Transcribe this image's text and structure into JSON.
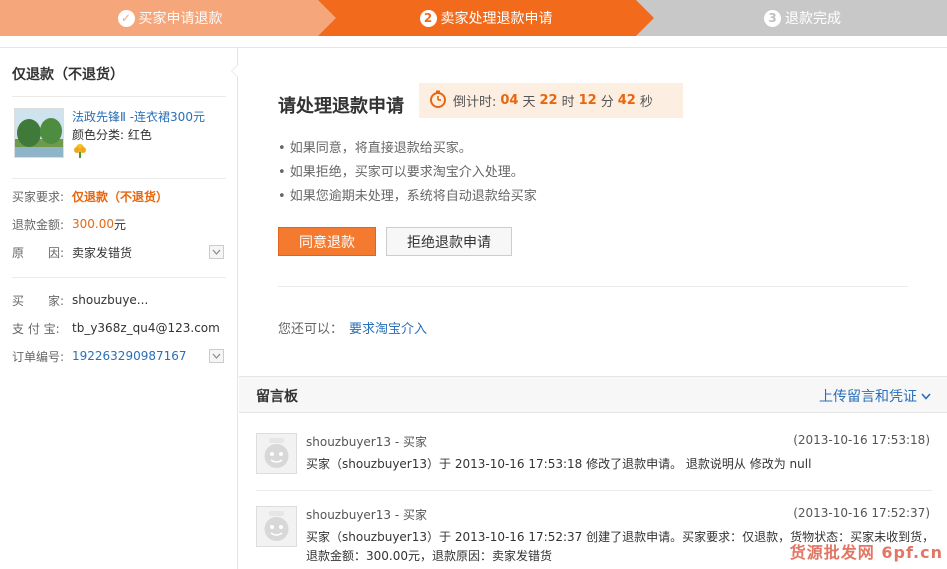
{
  "steps": [
    {
      "label": "买家申请退款",
      "state": "done"
    },
    {
      "label": "卖家处理退款申请",
      "num": "2",
      "state": "current"
    },
    {
      "label": "退款完成",
      "num": "3",
      "state": "todo"
    }
  ],
  "colors": {
    "step_done": "#f6a67b",
    "step_current": "#f26b1d",
    "step_todo": "#c8c8c8",
    "accent": "#e8660e",
    "link": "#2a6fb8"
  },
  "sidebar": {
    "title": "仅退款（不退货）",
    "product": {
      "name": "法政先锋Ⅱ -连衣裙300元",
      "attr": "颜色分类: 红色"
    },
    "details": [
      {
        "key": "买家要求:",
        "value": "仅退款（不退货）"
      },
      {
        "key": "退款金额:",
        "value": "300.00",
        "suffix": "元"
      },
      {
        "key": "原　　因:",
        "value": "卖家发错货"
      }
    ],
    "buyer_info": [
      {
        "key": "买　　家:",
        "value": "shouzbuye..."
      },
      {
        "key": "支 付 宝:",
        "value": "tb_y368z_qu4@123.com"
      },
      {
        "key": "订单编号:",
        "value": "192263290987167"
      }
    ]
  },
  "main": {
    "title": "请处理退款申请",
    "countdown": {
      "label": "倒计时:",
      "days": "04",
      "days_unit": "天",
      "hours": "22",
      "hours_unit": "时",
      "minutes": "12",
      "minutes_unit": "分",
      "seconds": "42",
      "seconds_unit": "秒"
    },
    "bullets": [
      "• 如果同意，将直接退款给买家。",
      "• 如果拒绝，买家可以要求淘宝介入处理。",
      "• 如果您逾期未处理，系统将自动退款给买家"
    ],
    "agree_label": "同意退款",
    "refuse_label": "拒绝退款申请",
    "also_label": "您还可以：",
    "also_link": "要求淘宝介入"
  },
  "board": {
    "title": "留言板",
    "upload_label": "上传留言和凭证",
    "messages": [
      {
        "who": "shouzbuyer13 - 买家",
        "time": "(2013-10-16 17:53:18)",
        "text": "买家（shouzbuyer13）于 2013-10-16 17:53:18 修改了退款申请。 退款说明从 修改为 null"
      },
      {
        "who": "shouzbuyer13 - 买家",
        "time": "(2013-10-16 17:52:37)",
        "text": "买家（shouzbuyer13）于 2013-10-16 17:52:37 创建了退款申请。买家要求：仅退款，货物状态：买家未收到货，退款金额：300.00元，退款原因：卖家发错货"
      }
    ]
  },
  "watermark": "货源批发网 6pf.cn"
}
